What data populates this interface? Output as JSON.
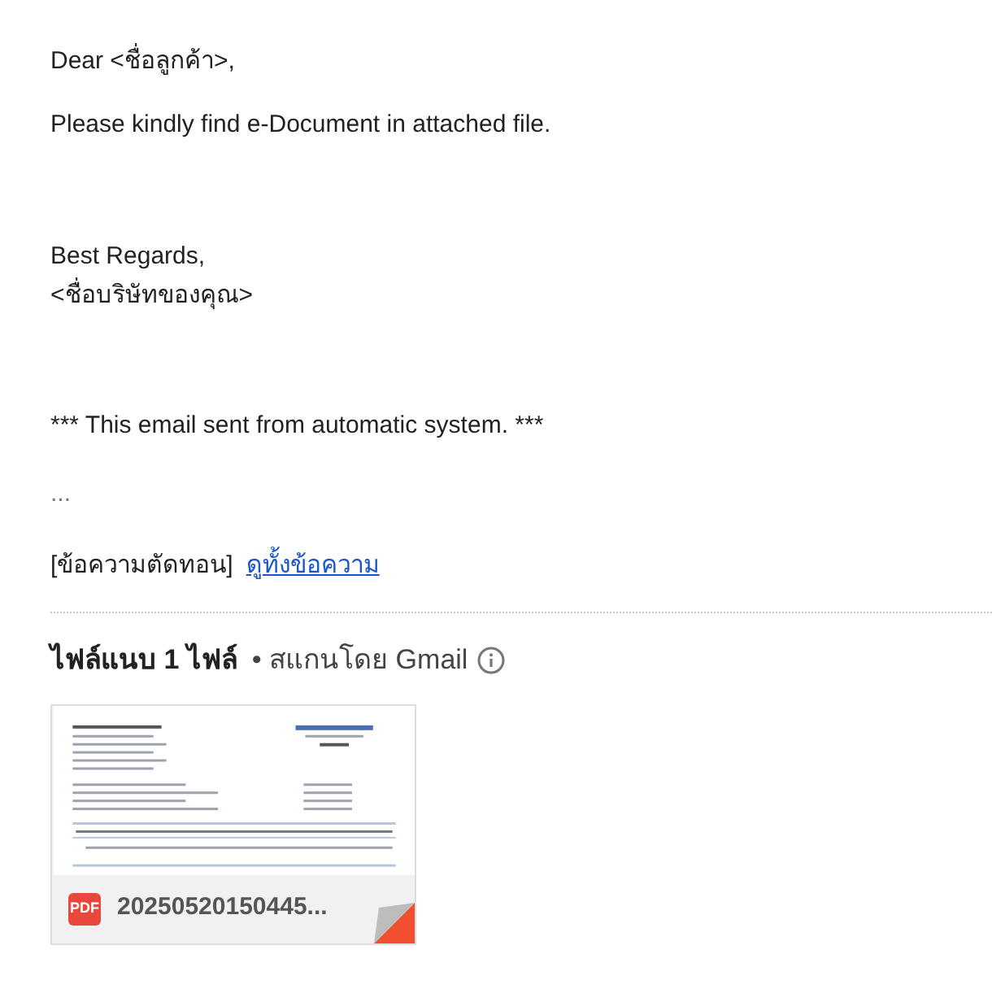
{
  "body": {
    "greeting": "Dear <ชื่อลูกค้า>,",
    "paragraphs": [
      "Please kindly find e-Document in attached file."
    ],
    "closing": "Best Regards,",
    "signature": "<ชื่อบริษัทของคุณ>",
    "notice": "*** This email sent from automatic system. ***",
    "ellipsis": "...",
    "trimmed_label": "[ข้อความตัดทอน]",
    "show_all_link": "ดูทั้งข้อความ"
  },
  "attachments": {
    "title": "ไฟล์แนบ 1 ไฟล์",
    "scan_note": "• สแกนโดย Gmail",
    "files": [
      {
        "type_badge": "PDF",
        "name": "20250520150445..."
      }
    ]
  }
}
